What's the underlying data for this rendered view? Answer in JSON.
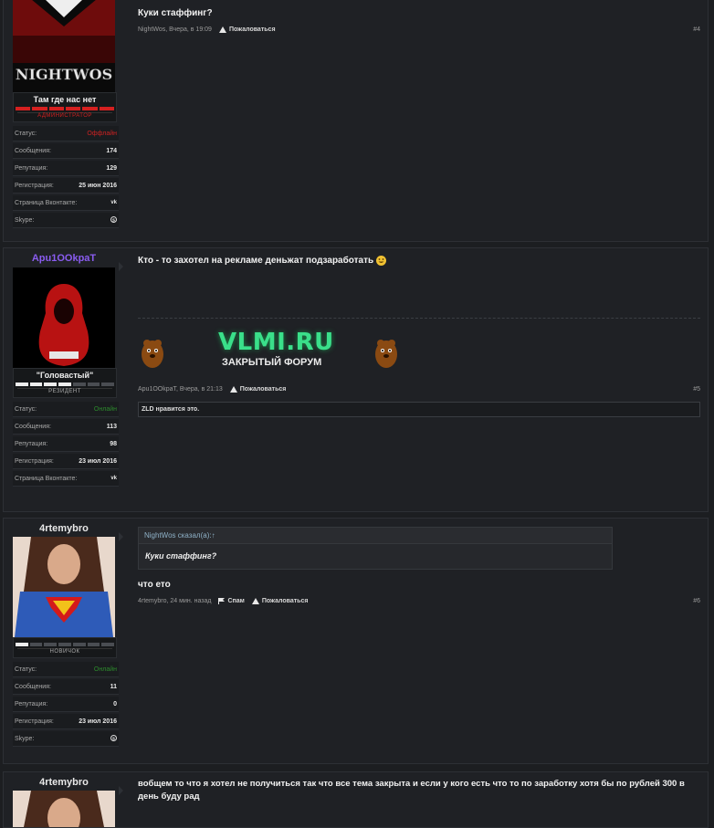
{
  "colors": {
    "offline": "#cc2222",
    "online": "#2d8a2d",
    "purple": "#8a5cf0",
    "accent_red": "#d42020"
  },
  "posts": [
    {
      "username": "",
      "avatar_text": "NIGHTWOS",
      "user_title": "Там где нас нет",
      "rank_label": "АДМИНИСТРАТОР",
      "stats": [
        {
          "label": "Статус:",
          "value": "Оффлайн"
        },
        {
          "label": "Сообщения:",
          "value": "174"
        },
        {
          "label": "Репутация:",
          "value": "129"
        },
        {
          "label": "Регистрация:",
          "value": "25 июн 2016"
        },
        {
          "label": "Страница Вконтакте:",
          "value": "vk"
        },
        {
          "label": "Skype:",
          "value": "skype"
        }
      ],
      "message": "Куки стаффинг?",
      "meta_author": "NightWos, Вчера, в 19:09",
      "report_label": "Пожаловаться",
      "post_number": "#4"
    },
    {
      "username": "Apu1OOkpaT",
      "user_title": "\"Головастый\"",
      "rank_label": "РЕЗИДЕНТ",
      "stats": [
        {
          "label": "Статус:",
          "value": "Онлайн"
        },
        {
          "label": "Сообщения:",
          "value": "113"
        },
        {
          "label": "Репутация:",
          "value": "98"
        },
        {
          "label": "Регистрация:",
          "value": "23 июл 2016"
        },
        {
          "label": "Страница Вконтакте:",
          "value": "vk"
        }
      ],
      "message": "Кто - то захотел на рекламе деньжат подзаработать",
      "banner_title": "VLMI.RU",
      "banner_subtitle": "ЗАКРЫТЫЙ ФОРУМ",
      "meta_author": "Apu1OOkpaT, Вчера, в 21:13",
      "report_label": "Пожаловаться",
      "post_number": "#5",
      "likes_text": "ZLD нравится это."
    },
    {
      "username": "4rtemybro",
      "rank_label": "НОВИЧОК",
      "stats": [
        {
          "label": "Статус:",
          "value": "Онлайн"
        },
        {
          "label": "Сообщения:",
          "value": "11"
        },
        {
          "label": "Репутация:",
          "value": "0"
        },
        {
          "label": "Регистрация:",
          "value": "23 июл 2016"
        },
        {
          "label": "Skype:",
          "value": "skype"
        }
      ],
      "quote_author": "NightWos сказал(а):↑",
      "quote_text": "Куки стаффинг?",
      "message": "что ето",
      "meta_author": "4rtemybro, 24 мин. назад",
      "spam_label": "Спам",
      "report_label": "Пожаловаться",
      "post_number": "#6"
    },
    {
      "username": "4rtemybro",
      "message": "вобщем то что я хотел не получиться так что все тема закрыта и если у кого есть что то по заработку хотя бы по рублей 300 в день буду рад"
    }
  ]
}
